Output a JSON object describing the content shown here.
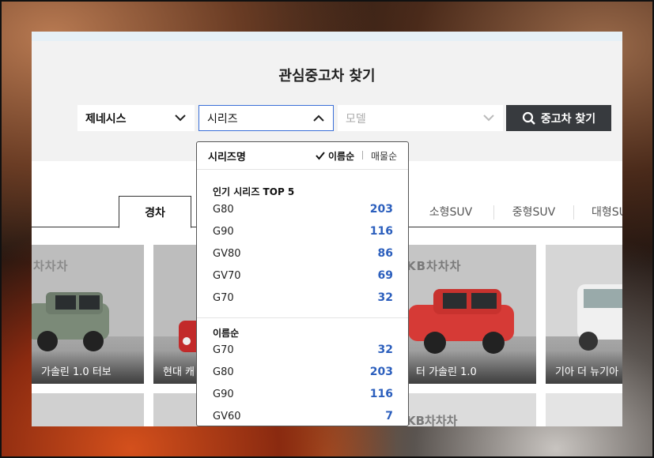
{
  "page": {
    "title": "관심중고차 찾기"
  },
  "filters": {
    "brand": "제네시스",
    "series_placeholder": "시리즈",
    "model_placeholder": "모델",
    "search_button": "중고차 찾기"
  },
  "tabs": [
    "경차",
    "소형SUV",
    "중형SUV",
    "대형SUV"
  ],
  "cards": [
    {
      "caption": "가솔린 1.0 터보",
      "logo": "차차차"
    },
    {
      "caption": "현대 캐",
      "logo": ""
    },
    {
      "caption": "터 가솔린 1.0",
      "logo": "KB차차차"
    },
    {
      "caption": "기아 더 뉴기아",
      "logo": ""
    }
  ],
  "bottom_logo": "KB차차차",
  "dropdown": {
    "title": "시리즈명",
    "sort_selected": "이름순",
    "sort_other": "매물순",
    "popular": {
      "heading": "인기 시리즈 TOP 5",
      "items": [
        {
          "name": "G80",
          "count": "203"
        },
        {
          "name": "G90",
          "count": "116"
        },
        {
          "name": "GV80",
          "count": "86"
        },
        {
          "name": "GV70",
          "count": "69"
        },
        {
          "name": "G70",
          "count": "32"
        }
      ]
    },
    "byname": {
      "heading": "이름순",
      "items": [
        {
          "name": "G70",
          "count": "32"
        },
        {
          "name": "G80",
          "count": "203"
        },
        {
          "name": "G90",
          "count": "116"
        },
        {
          "name": "GV60",
          "count": "7"
        }
      ]
    }
  },
  "colors": {
    "accent_blue": "#2c5fbd",
    "button_dark": "#373a3e",
    "focus_border": "#3a6fd8"
  },
  "icons": {
    "chevron": "chevron-down-icon",
    "chevron_up": "chevron-up-icon",
    "search": "search-icon",
    "check": "check-icon"
  }
}
